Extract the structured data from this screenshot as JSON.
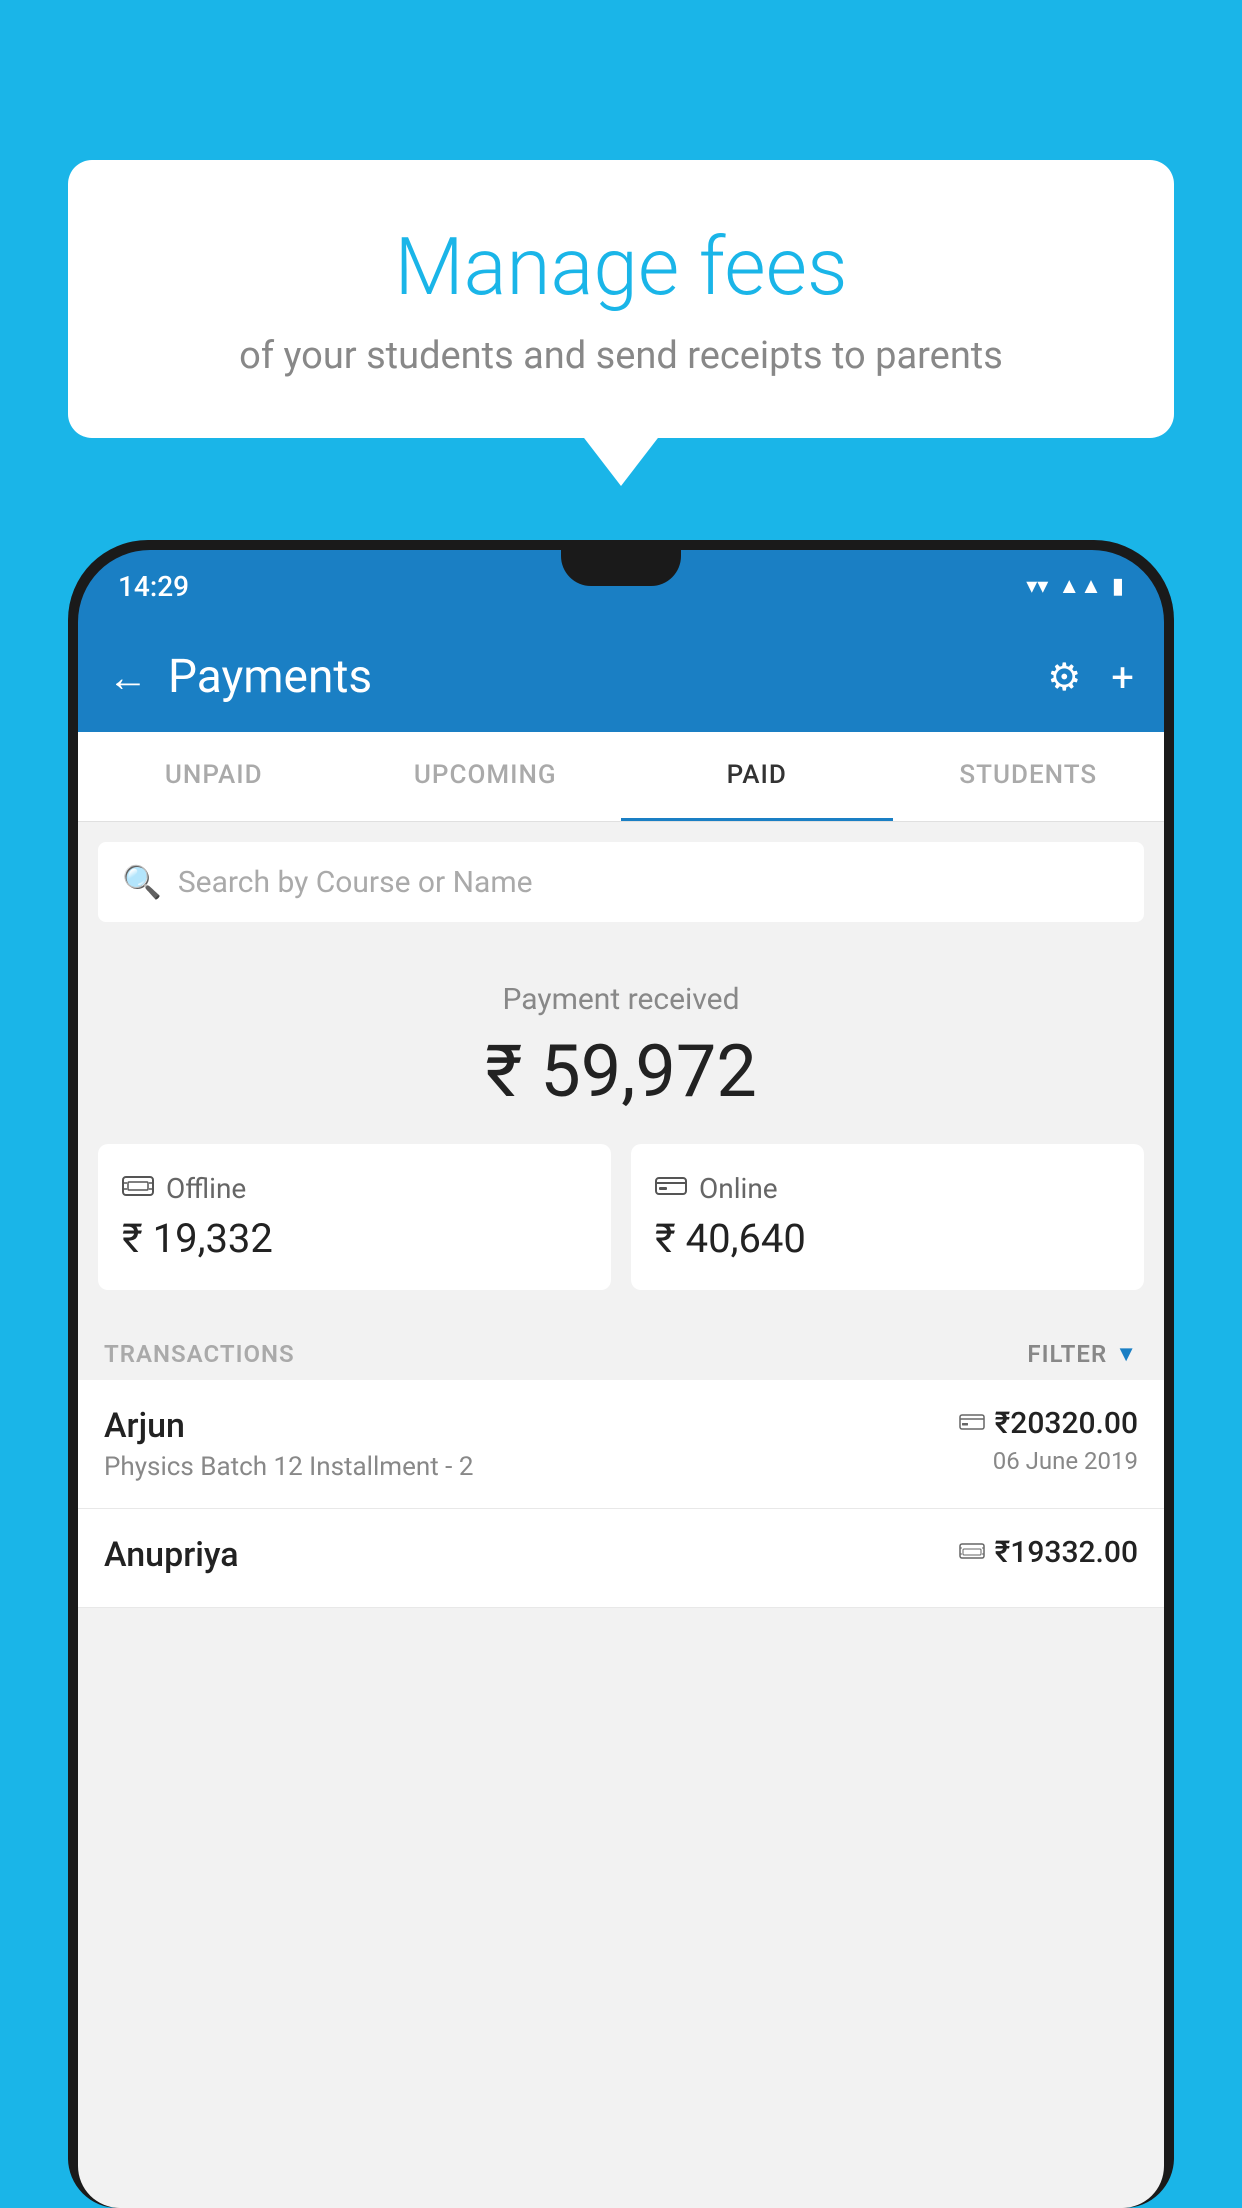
{
  "background_color": "#1ab5e8",
  "speech_bubble": {
    "title": "Manage fees",
    "subtitle": "of your students and send receipts to parents"
  },
  "status_bar": {
    "time": "14:29",
    "wifi_icon": "▲",
    "signal_icon": "▲",
    "battery_icon": "▮"
  },
  "app_bar": {
    "back_label": "←",
    "title": "Payments",
    "settings_icon": "⚙",
    "add_icon": "+"
  },
  "tabs": [
    {
      "label": "UNPAID",
      "active": false
    },
    {
      "label": "UPCOMING",
      "active": false
    },
    {
      "label": "PAID",
      "active": true
    },
    {
      "label": "STUDENTS",
      "active": false
    }
  ],
  "search": {
    "placeholder": "Search by Course or Name"
  },
  "payment_received": {
    "label": "Payment received",
    "amount": "₹ 59,972"
  },
  "payment_cards": [
    {
      "type": "Offline",
      "amount": "₹ 19,332",
      "icon": "💳"
    },
    {
      "type": "Online",
      "amount": "₹ 40,640",
      "icon": "💳"
    }
  ],
  "transactions": {
    "label": "TRANSACTIONS",
    "filter_label": "FILTER",
    "rows": [
      {
        "name": "Arjun",
        "course": "Physics Batch 12 Installment - 2",
        "icon": "💳",
        "amount": "₹20320.00",
        "date": "06 June 2019"
      },
      {
        "name": "Anupriya",
        "course": "",
        "icon": "💵",
        "amount": "₹19332.00",
        "date": ""
      }
    ]
  }
}
